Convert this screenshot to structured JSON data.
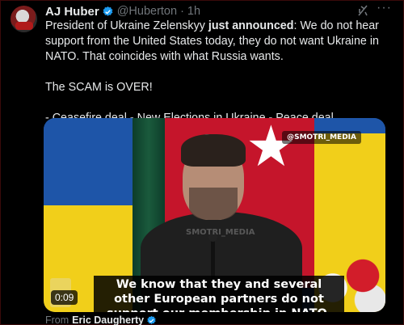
{
  "tweet": {
    "display_name": "AJ Huber",
    "handle": "@Huberton",
    "separator": "·",
    "time": "1h",
    "more": "···",
    "text_p1_pre": "President of Ukraine Zelenskyy ",
    "text_p1_bold": "just announced",
    "text_p1_post": ": We do not hear support from the United States today, they do not want Ukraine in NATO. That coincides with what Russia wants.",
    "text_p2": "The SCAM is OVER!",
    "text_p3": "- Ceasefire deal - New Elections in Ukraine - Peace deal"
  },
  "media": {
    "watermark_tag": "@SMOTRI_MEDIA",
    "watermark_mid": "SMOTRI_MEDIA",
    "caption": "We know that they and several other European partners do not support our membership in NATO.",
    "duration": "0:09"
  },
  "attribution": {
    "prefix": "From",
    "name": "Eric Daugherty"
  },
  "colors": {
    "background": "#000000",
    "text": "#e7e9ea",
    "muted": "#71767b",
    "verified": "#1d9bf0"
  },
  "icons": [
    "verified-badge-icon",
    "grok-icon",
    "more-icon"
  ]
}
